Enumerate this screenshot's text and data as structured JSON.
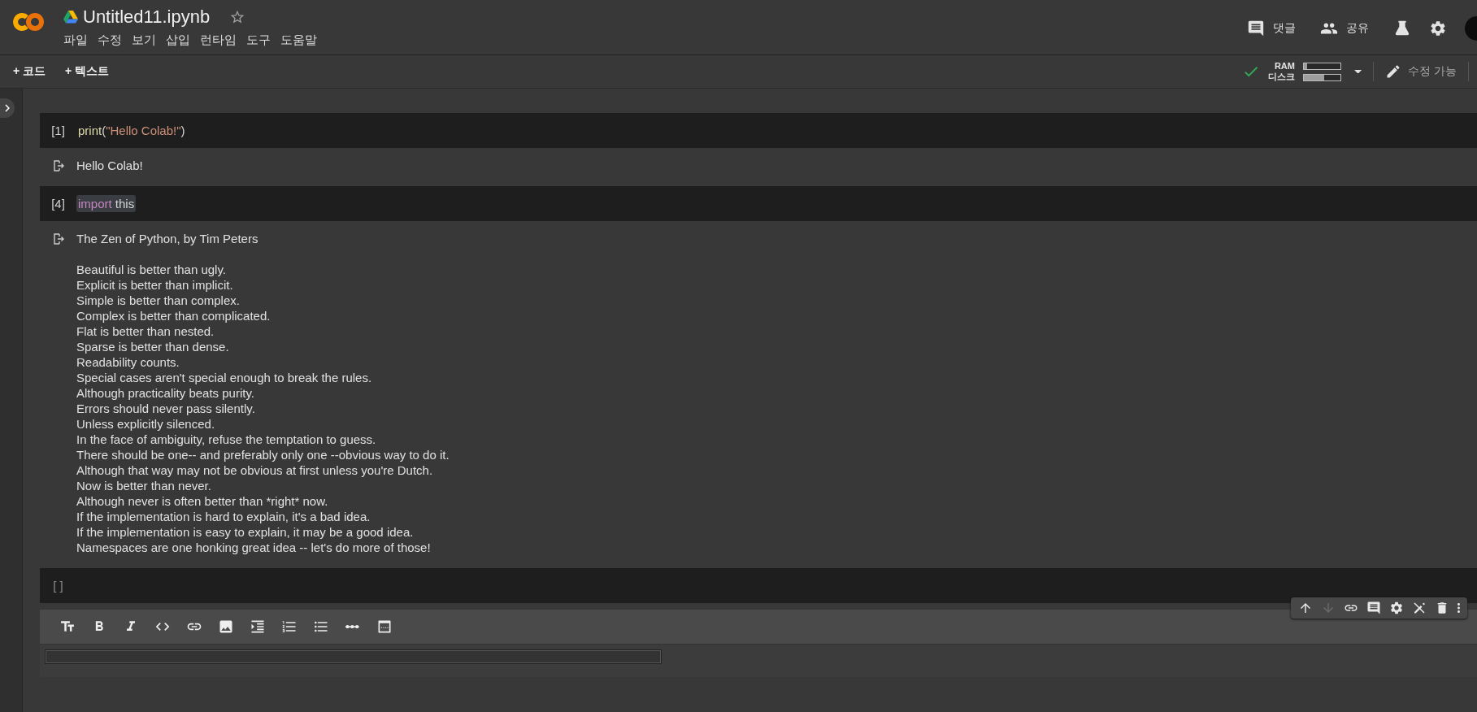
{
  "header": {
    "title": "Untitled11.ipynb",
    "starred": false,
    "menu": [
      "파일",
      "수정",
      "보기",
      "삽입",
      "런타임",
      "도구",
      "도움말"
    ],
    "actions": [
      {
        "kind": "comment",
        "label": "댓글"
      },
      {
        "kind": "share",
        "label": "공유"
      }
    ]
  },
  "toolbar": {
    "add_buttons": [
      "+ 코드",
      "+ 텍스트"
    ],
    "resources": {
      "connected": true,
      "ram": {
        "label": "RAM",
        "level": 0.08
      },
      "disk": {
        "label": "디스크",
        "level": 0.55
      }
    },
    "edit_mode": {
      "label": "수정 가능"
    }
  },
  "cells": [
    {
      "kind": "code",
      "count": "[1]",
      "executed": true,
      "code_selected": false,
      "code": [
        {
          "kind": "function",
          "text": "print"
        },
        {
          "kind": "plain",
          "text": "("
        },
        {
          "kind": "string",
          "text": "\"Hello Colab!\""
        },
        {
          "kind": "plain",
          "text": ")"
        }
      ],
      "output_blocks": [
        [
          "Hello Colab!"
        ]
      ]
    },
    {
      "kind": "code",
      "count": "[4]",
      "executed": true,
      "code_selected": true,
      "code": [
        {
          "kind": "keyword",
          "text": "import"
        },
        {
          "kind": "plain",
          "text": " this"
        }
      ],
      "output_blocks": [
        [
          "The Zen of Python, by Tim Peters"
        ],
        [
          "Beautiful is better than ugly.",
          "Explicit is better than implicit.",
          "Simple is better than complex.",
          "Complex is better than complicated.",
          "Flat is better than nested.",
          "Sparse is better than dense.",
          "Readability counts.",
          "Special cases aren't special enough to break the rules.",
          "Although practicality beats purity.",
          "Errors should never pass silently.",
          "Unless explicitly silenced.",
          "In the face of ambiguity, refuse the temptation to guess.",
          "There should be one-- and preferably only one --obvious way to do it.",
          "Although that way may not be obvious at first unless you're Dutch.",
          "Now is better than never.",
          "Although never is often better than *right* now.",
          "If the implementation is hard to explain, it's a bad idea.",
          "If the implementation is easy to explain, it may be a good idea.",
          "Namespaces are one honking great idea -- let's do more of those!"
        ]
      ]
    },
    {
      "kind": "code",
      "count": "[ ]",
      "executed": false
    },
    {
      "kind": "text",
      "format_tools": [
        {
          "kind": "heading"
        },
        {
          "kind": "bold"
        },
        {
          "kind": "italic"
        },
        {
          "kind": "code"
        },
        {
          "kind": "link"
        },
        {
          "kind": "image"
        },
        {
          "kind": "indent"
        },
        {
          "kind": "numbered-list"
        },
        {
          "kind": "bullet-list"
        },
        {
          "kind": "rule"
        },
        {
          "kind": "embed"
        }
      ],
      "cell_tools": [
        {
          "kind": "move-up",
          "disabled": false
        },
        {
          "kind": "move-down",
          "disabled": true
        },
        {
          "kind": "link",
          "disabled": false
        },
        {
          "kind": "comment",
          "disabled": false
        },
        {
          "kind": "settings",
          "disabled": false
        },
        {
          "kind": "edit-off",
          "disabled": false
        },
        {
          "kind": "delete",
          "disabled": false
        },
        {
          "kind": "more",
          "disabled": false
        }
      ]
    }
  ]
}
